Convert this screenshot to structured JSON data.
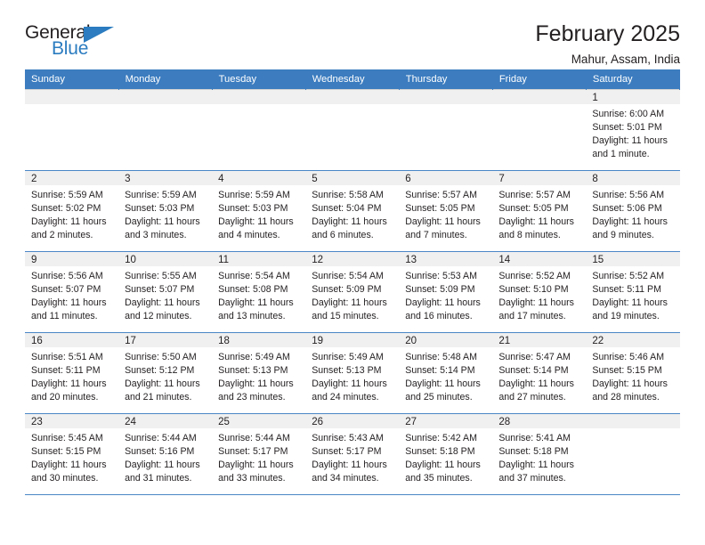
{
  "brand": {
    "name_top": "General",
    "name_bottom": "Blue",
    "accent_color": "#2b7cc0"
  },
  "header": {
    "title": "February 2025",
    "subtitle": "Mahur, Assam, India"
  },
  "calendar": {
    "header_bg": "#3c7cbf",
    "daynum_bg": "#f0f0f0",
    "weekday_headers": [
      "Sunday",
      "Monday",
      "Tuesday",
      "Wednesday",
      "Thursday",
      "Friday",
      "Saturday"
    ],
    "weeks": [
      [
        {
          "day": "",
          "sunrise": "",
          "sunset": "",
          "daylight1": "",
          "daylight2": ""
        },
        {
          "day": "",
          "sunrise": "",
          "sunset": "",
          "daylight1": "",
          "daylight2": ""
        },
        {
          "day": "",
          "sunrise": "",
          "sunset": "",
          "daylight1": "",
          "daylight2": ""
        },
        {
          "day": "",
          "sunrise": "",
          "sunset": "",
          "daylight1": "",
          "daylight2": ""
        },
        {
          "day": "",
          "sunrise": "",
          "sunset": "",
          "daylight1": "",
          "daylight2": ""
        },
        {
          "day": "",
          "sunrise": "",
          "sunset": "",
          "daylight1": "",
          "daylight2": ""
        },
        {
          "day": "1",
          "sunrise": "Sunrise: 6:00 AM",
          "sunset": "Sunset: 5:01 PM",
          "daylight1": "Daylight: 11 hours",
          "daylight2": "and 1 minute."
        }
      ],
      [
        {
          "day": "2",
          "sunrise": "Sunrise: 5:59 AM",
          "sunset": "Sunset: 5:02 PM",
          "daylight1": "Daylight: 11 hours",
          "daylight2": "and 2 minutes."
        },
        {
          "day": "3",
          "sunrise": "Sunrise: 5:59 AM",
          "sunset": "Sunset: 5:03 PM",
          "daylight1": "Daylight: 11 hours",
          "daylight2": "and 3 minutes."
        },
        {
          "day": "4",
          "sunrise": "Sunrise: 5:59 AM",
          "sunset": "Sunset: 5:03 PM",
          "daylight1": "Daylight: 11 hours",
          "daylight2": "and 4 minutes."
        },
        {
          "day": "5",
          "sunrise": "Sunrise: 5:58 AM",
          "sunset": "Sunset: 5:04 PM",
          "daylight1": "Daylight: 11 hours",
          "daylight2": "and 6 minutes."
        },
        {
          "day": "6",
          "sunrise": "Sunrise: 5:57 AM",
          "sunset": "Sunset: 5:05 PM",
          "daylight1": "Daylight: 11 hours",
          "daylight2": "and 7 minutes."
        },
        {
          "day": "7",
          "sunrise": "Sunrise: 5:57 AM",
          "sunset": "Sunset: 5:05 PM",
          "daylight1": "Daylight: 11 hours",
          "daylight2": "and 8 minutes."
        },
        {
          "day": "8",
          "sunrise": "Sunrise: 5:56 AM",
          "sunset": "Sunset: 5:06 PM",
          "daylight1": "Daylight: 11 hours",
          "daylight2": "and 9 minutes."
        }
      ],
      [
        {
          "day": "9",
          "sunrise": "Sunrise: 5:56 AM",
          "sunset": "Sunset: 5:07 PM",
          "daylight1": "Daylight: 11 hours",
          "daylight2": "and 11 minutes."
        },
        {
          "day": "10",
          "sunrise": "Sunrise: 5:55 AM",
          "sunset": "Sunset: 5:07 PM",
          "daylight1": "Daylight: 11 hours",
          "daylight2": "and 12 minutes."
        },
        {
          "day": "11",
          "sunrise": "Sunrise: 5:54 AM",
          "sunset": "Sunset: 5:08 PM",
          "daylight1": "Daylight: 11 hours",
          "daylight2": "and 13 minutes."
        },
        {
          "day": "12",
          "sunrise": "Sunrise: 5:54 AM",
          "sunset": "Sunset: 5:09 PM",
          "daylight1": "Daylight: 11 hours",
          "daylight2": "and 15 minutes."
        },
        {
          "day": "13",
          "sunrise": "Sunrise: 5:53 AM",
          "sunset": "Sunset: 5:09 PM",
          "daylight1": "Daylight: 11 hours",
          "daylight2": "and 16 minutes."
        },
        {
          "day": "14",
          "sunrise": "Sunrise: 5:52 AM",
          "sunset": "Sunset: 5:10 PM",
          "daylight1": "Daylight: 11 hours",
          "daylight2": "and 17 minutes."
        },
        {
          "day": "15",
          "sunrise": "Sunrise: 5:52 AM",
          "sunset": "Sunset: 5:11 PM",
          "daylight1": "Daylight: 11 hours",
          "daylight2": "and 19 minutes."
        }
      ],
      [
        {
          "day": "16",
          "sunrise": "Sunrise: 5:51 AM",
          "sunset": "Sunset: 5:11 PM",
          "daylight1": "Daylight: 11 hours",
          "daylight2": "and 20 minutes."
        },
        {
          "day": "17",
          "sunrise": "Sunrise: 5:50 AM",
          "sunset": "Sunset: 5:12 PM",
          "daylight1": "Daylight: 11 hours",
          "daylight2": "and 21 minutes."
        },
        {
          "day": "18",
          "sunrise": "Sunrise: 5:49 AM",
          "sunset": "Sunset: 5:13 PM",
          "daylight1": "Daylight: 11 hours",
          "daylight2": "and 23 minutes."
        },
        {
          "day": "19",
          "sunrise": "Sunrise: 5:49 AM",
          "sunset": "Sunset: 5:13 PM",
          "daylight1": "Daylight: 11 hours",
          "daylight2": "and 24 minutes."
        },
        {
          "day": "20",
          "sunrise": "Sunrise: 5:48 AM",
          "sunset": "Sunset: 5:14 PM",
          "daylight1": "Daylight: 11 hours",
          "daylight2": "and 25 minutes."
        },
        {
          "day": "21",
          "sunrise": "Sunrise: 5:47 AM",
          "sunset": "Sunset: 5:14 PM",
          "daylight1": "Daylight: 11 hours",
          "daylight2": "and 27 minutes."
        },
        {
          "day": "22",
          "sunrise": "Sunrise: 5:46 AM",
          "sunset": "Sunset: 5:15 PM",
          "daylight1": "Daylight: 11 hours",
          "daylight2": "and 28 minutes."
        }
      ],
      [
        {
          "day": "23",
          "sunrise": "Sunrise: 5:45 AM",
          "sunset": "Sunset: 5:15 PM",
          "daylight1": "Daylight: 11 hours",
          "daylight2": "and 30 minutes."
        },
        {
          "day": "24",
          "sunrise": "Sunrise: 5:44 AM",
          "sunset": "Sunset: 5:16 PM",
          "daylight1": "Daylight: 11 hours",
          "daylight2": "and 31 minutes."
        },
        {
          "day": "25",
          "sunrise": "Sunrise: 5:44 AM",
          "sunset": "Sunset: 5:17 PM",
          "daylight1": "Daylight: 11 hours",
          "daylight2": "and 33 minutes."
        },
        {
          "day": "26",
          "sunrise": "Sunrise: 5:43 AM",
          "sunset": "Sunset: 5:17 PM",
          "daylight1": "Daylight: 11 hours",
          "daylight2": "and 34 minutes."
        },
        {
          "day": "27",
          "sunrise": "Sunrise: 5:42 AM",
          "sunset": "Sunset: 5:18 PM",
          "daylight1": "Daylight: 11 hours",
          "daylight2": "and 35 minutes."
        },
        {
          "day": "28",
          "sunrise": "Sunrise: 5:41 AM",
          "sunset": "Sunset: 5:18 PM",
          "daylight1": "Daylight: 11 hours",
          "daylight2": "and 37 minutes."
        },
        {
          "day": "",
          "sunrise": "",
          "sunset": "",
          "daylight1": "",
          "daylight2": ""
        }
      ]
    ]
  }
}
